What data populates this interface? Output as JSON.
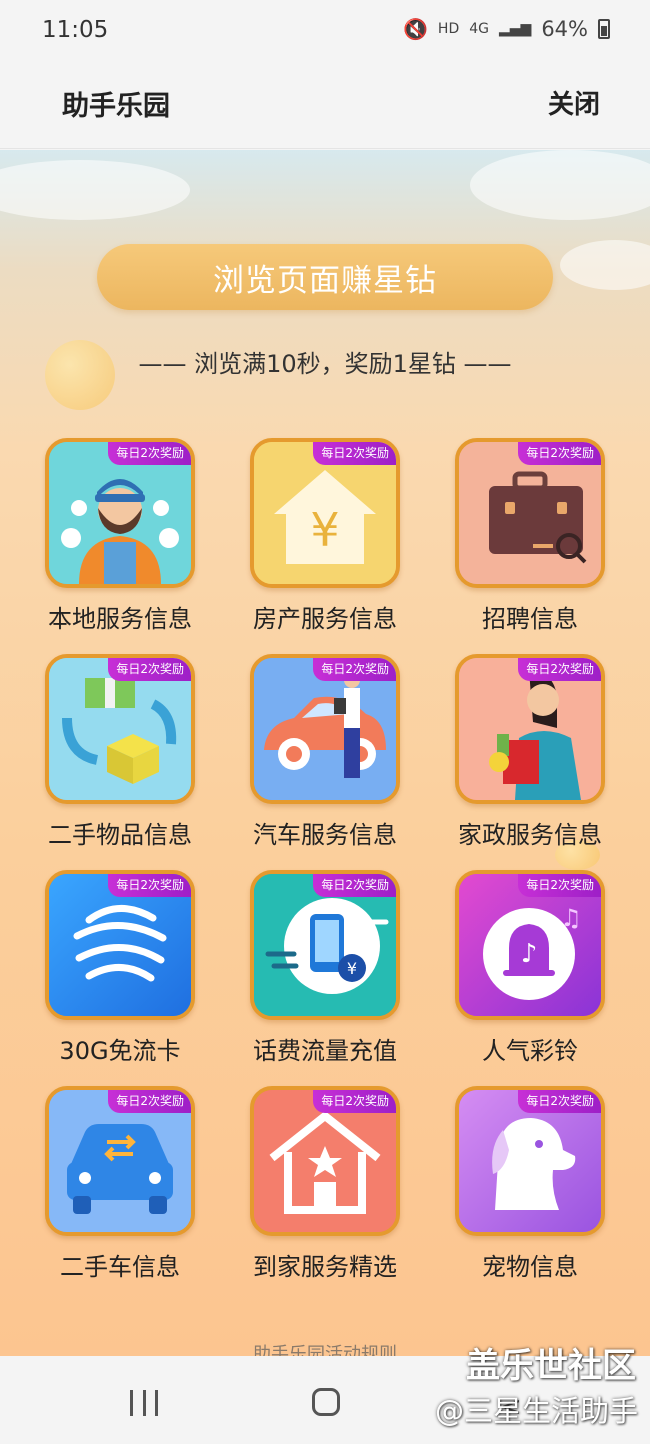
{
  "status_bar": {
    "time": "11:05",
    "network_hd": "HD",
    "network_4g": "4G",
    "battery_percent": "64%"
  },
  "header": {
    "title": "助手乐园",
    "close_label": "关闭"
  },
  "banner": {
    "label": "浏览页面赚星钻"
  },
  "subtitle": "—— 浏览满10秒，奖励1星钻 ——",
  "badge_text": "每日2次奖励",
  "tiles": [
    {
      "label": "本地服务信息",
      "icon": "service-worker-icon",
      "bg": "#5fd0d8"
    },
    {
      "label": "房产服务信息",
      "icon": "house-yuan-icon",
      "bg": "#f6d268"
    },
    {
      "label": "招聘信息",
      "icon": "briefcase-search-icon",
      "bg": "#f2a98c"
    },
    {
      "label": "二手物品信息",
      "icon": "exchange-items-icon",
      "bg": "#8fd8ee"
    },
    {
      "label": "汽车服务信息",
      "icon": "car-mechanic-icon",
      "bg": "#6fa8f0"
    },
    {
      "label": "家政服务信息",
      "icon": "housekeeper-icon",
      "bg": "#f7a58f"
    },
    {
      "label": "30G免流卡",
      "icon": "china-mobile-logo-icon",
      "bg": "#2e8ef0"
    },
    {
      "label": "话费流量充值",
      "icon": "phone-recharge-icon",
      "bg": "#23b7b0"
    },
    {
      "label": "人气彩铃",
      "icon": "music-bell-icon",
      "bg": "#c43fd2"
    },
    {
      "label": "二手车信息",
      "icon": "car-swap-icon",
      "bg": "#7fb2f6"
    },
    {
      "label": "到家服务精选",
      "icon": "home-star-icon",
      "bg": "#f27a6c"
    },
    {
      "label": "宠物信息",
      "icon": "pet-dog-icon",
      "bg": "#b46ae8"
    }
  ],
  "rules_link": "助手乐园活动规则",
  "watermark": {
    "line1": "盖乐世社区",
    "line2": "@三星生活助手"
  }
}
